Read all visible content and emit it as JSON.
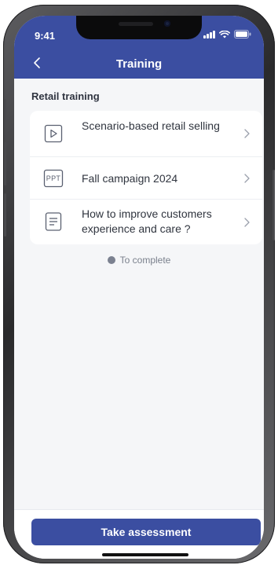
{
  "status_bar": {
    "time": "9:41"
  },
  "header": {
    "title": "Training"
  },
  "section": {
    "title": "Retail training"
  },
  "items": [
    {
      "label": "Scenario-based retail selling",
      "icon": "play-icon"
    },
    {
      "label": "Fall campaign 2024",
      "icon": "ppt-icon",
      "icon_text": "PPT"
    },
    {
      "label": "How to improve customers experience and care ?",
      "icon": "document-icon"
    }
  ],
  "legend": {
    "label": "To complete",
    "color": "#7b8190"
  },
  "footer": {
    "button_label": "Take assessment"
  },
  "colors": {
    "primary": "#3b4ea1",
    "background": "#f5f6f8"
  }
}
